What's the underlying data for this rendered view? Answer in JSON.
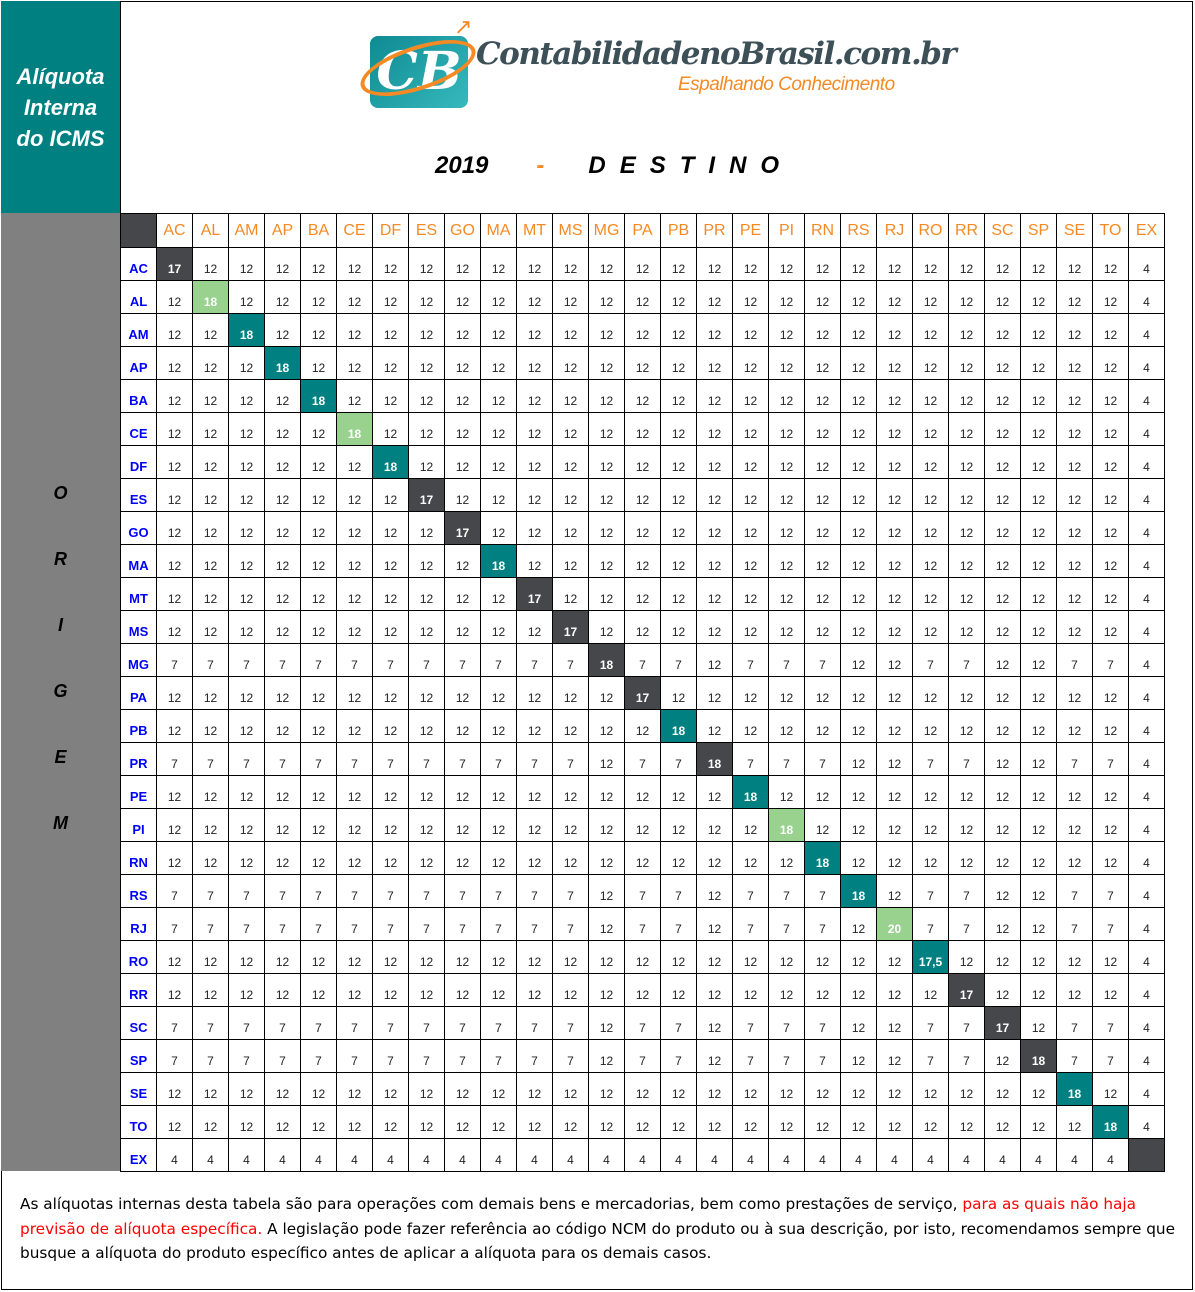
{
  "title": {
    "line1": "Alíquota",
    "line2": "Interna",
    "line3": "do ICMS"
  },
  "logo": {
    "mark": "CB",
    "name": "ContabilidadenoBrasil.com.br",
    "tagline": "Espalhando Conhecimento"
  },
  "heading": {
    "year": "2019",
    "dash": "-",
    "label": "DESTINO"
  },
  "origin_label": [
    "O",
    "R",
    "I",
    "G",
    "E",
    "M"
  ],
  "colors": {
    "teal": "#008080",
    "dark": "#46474b",
    "green": "#99d18f",
    "header_text": "#f58a25",
    "row_label": "#0000ff",
    "highlight": "#ff0000"
  },
  "table": {
    "columns": [
      "AC",
      "AL",
      "AM",
      "AP",
      "BA",
      "CE",
      "DF",
      "ES",
      "GO",
      "MA",
      "MT",
      "MS",
      "MG",
      "PA",
      "PB",
      "PR",
      "PE",
      "PI",
      "RN",
      "RS",
      "RJ",
      "RO",
      "RR",
      "SC",
      "SP",
      "SE",
      "TO",
      "EX"
    ],
    "rows": [
      {
        "origin": "AC",
        "diag": "dark",
        "values": [
          "17",
          "12",
          "12",
          "12",
          "12",
          "12",
          "12",
          "12",
          "12",
          "12",
          "12",
          "12",
          "12",
          "12",
          "12",
          "12",
          "12",
          "12",
          "12",
          "12",
          "12",
          "12",
          "12",
          "12",
          "12",
          "12",
          "12",
          "4"
        ]
      },
      {
        "origin": "AL",
        "diag": "green",
        "values": [
          "12",
          "18",
          "12",
          "12",
          "12",
          "12",
          "12",
          "12",
          "12",
          "12",
          "12",
          "12",
          "12",
          "12",
          "12",
          "12",
          "12",
          "12",
          "12",
          "12",
          "12",
          "12",
          "12",
          "12",
          "12",
          "12",
          "12",
          "4"
        ]
      },
      {
        "origin": "AM",
        "diag": "teal",
        "values": [
          "12",
          "12",
          "18",
          "12",
          "12",
          "12",
          "12",
          "12",
          "12",
          "12",
          "12",
          "12",
          "12",
          "12",
          "12",
          "12",
          "12",
          "12",
          "12",
          "12",
          "12",
          "12",
          "12",
          "12",
          "12",
          "12",
          "12",
          "4"
        ]
      },
      {
        "origin": "AP",
        "diag": "teal",
        "values": [
          "12",
          "12",
          "12",
          "18",
          "12",
          "12",
          "12",
          "12",
          "12",
          "12",
          "12",
          "12",
          "12",
          "12",
          "12",
          "12",
          "12",
          "12",
          "12",
          "12",
          "12",
          "12",
          "12",
          "12",
          "12",
          "12",
          "12",
          "4"
        ]
      },
      {
        "origin": "BA",
        "diag": "teal",
        "values": [
          "12",
          "12",
          "12",
          "12",
          "18",
          "12",
          "12",
          "12",
          "12",
          "12",
          "12",
          "12",
          "12",
          "12",
          "12",
          "12",
          "12",
          "12",
          "12",
          "12",
          "12",
          "12",
          "12",
          "12",
          "12",
          "12",
          "12",
          "4"
        ]
      },
      {
        "origin": "CE",
        "diag": "green",
        "values": [
          "12",
          "12",
          "12",
          "12",
          "12",
          "18",
          "12",
          "12",
          "12",
          "12",
          "12",
          "12",
          "12",
          "12",
          "12",
          "12",
          "12",
          "12",
          "12",
          "12",
          "12",
          "12",
          "12",
          "12",
          "12",
          "12",
          "12",
          "4"
        ]
      },
      {
        "origin": "DF",
        "diag": "teal",
        "values": [
          "12",
          "12",
          "12",
          "12",
          "12",
          "12",
          "18",
          "12",
          "12",
          "12",
          "12",
          "12",
          "12",
          "12",
          "12",
          "12",
          "12",
          "12",
          "12",
          "12",
          "12",
          "12",
          "12",
          "12",
          "12",
          "12",
          "12",
          "4"
        ]
      },
      {
        "origin": "ES",
        "diag": "dark",
        "values": [
          "12",
          "12",
          "12",
          "12",
          "12",
          "12",
          "12",
          "17",
          "12",
          "12",
          "12",
          "12",
          "12",
          "12",
          "12",
          "12",
          "12",
          "12",
          "12",
          "12",
          "12",
          "12",
          "12",
          "12",
          "12",
          "12",
          "12",
          "4"
        ]
      },
      {
        "origin": "GO",
        "diag": "dark",
        "values": [
          "12",
          "12",
          "12",
          "12",
          "12",
          "12",
          "12",
          "12",
          "17",
          "12",
          "12",
          "12",
          "12",
          "12",
          "12",
          "12",
          "12",
          "12",
          "12",
          "12",
          "12",
          "12",
          "12",
          "12",
          "12",
          "12",
          "12",
          "4"
        ]
      },
      {
        "origin": "MA",
        "diag": "teal",
        "values": [
          "12",
          "12",
          "12",
          "12",
          "12",
          "12",
          "12",
          "12",
          "12",
          "18",
          "12",
          "12",
          "12",
          "12",
          "12",
          "12",
          "12",
          "12",
          "12",
          "12",
          "12",
          "12",
          "12",
          "12",
          "12",
          "12",
          "12",
          "4"
        ]
      },
      {
        "origin": "MT",
        "diag": "dark",
        "values": [
          "12",
          "12",
          "12",
          "12",
          "12",
          "12",
          "12",
          "12",
          "12",
          "12",
          "17",
          "12",
          "12",
          "12",
          "12",
          "12",
          "12",
          "12",
          "12",
          "12",
          "12",
          "12",
          "12",
          "12",
          "12",
          "12",
          "12",
          "4"
        ]
      },
      {
        "origin": "MS",
        "diag": "dark",
        "values": [
          "12",
          "12",
          "12",
          "12",
          "12",
          "12",
          "12",
          "12",
          "12",
          "12",
          "12",
          "17",
          "12",
          "12",
          "12",
          "12",
          "12",
          "12",
          "12",
          "12",
          "12",
          "12",
          "12",
          "12",
          "12",
          "12",
          "12",
          "4"
        ]
      },
      {
        "origin": "MG",
        "diag": "dark",
        "values": [
          "7",
          "7",
          "7",
          "7",
          "7",
          "7",
          "7",
          "7",
          "7",
          "7",
          "7",
          "7",
          "18",
          "7",
          "7",
          "12",
          "7",
          "7",
          "7",
          "12",
          "12",
          "7",
          "7",
          "12",
          "12",
          "7",
          "7",
          "4"
        ]
      },
      {
        "origin": "PA",
        "diag": "dark",
        "values": [
          "12",
          "12",
          "12",
          "12",
          "12",
          "12",
          "12",
          "12",
          "12",
          "12",
          "12",
          "12",
          "12",
          "17",
          "12",
          "12",
          "12",
          "12",
          "12",
          "12",
          "12",
          "12",
          "12",
          "12",
          "12",
          "12",
          "12",
          "4"
        ]
      },
      {
        "origin": "PB",
        "diag": "teal",
        "values": [
          "12",
          "12",
          "12",
          "12",
          "12",
          "12",
          "12",
          "12",
          "12",
          "12",
          "12",
          "12",
          "12",
          "12",
          "18",
          "12",
          "12",
          "12",
          "12",
          "12",
          "12",
          "12",
          "12",
          "12",
          "12",
          "12",
          "12",
          "4"
        ]
      },
      {
        "origin": "PR",
        "diag": "dark",
        "values": [
          "7",
          "7",
          "7",
          "7",
          "7",
          "7",
          "7",
          "7",
          "7",
          "7",
          "7",
          "7",
          "12",
          "7",
          "7",
          "18",
          "7",
          "7",
          "7",
          "12",
          "12",
          "7",
          "7",
          "12",
          "12",
          "7",
          "7",
          "4"
        ]
      },
      {
        "origin": "PE",
        "diag": "teal",
        "values": [
          "12",
          "12",
          "12",
          "12",
          "12",
          "12",
          "12",
          "12",
          "12",
          "12",
          "12",
          "12",
          "12",
          "12",
          "12",
          "12",
          "18",
          "12",
          "12",
          "12",
          "12",
          "12",
          "12",
          "12",
          "12",
          "12",
          "12",
          "4"
        ]
      },
      {
        "origin": "PI",
        "diag": "green",
        "values": [
          "12",
          "12",
          "12",
          "12",
          "12",
          "12",
          "12",
          "12",
          "12",
          "12",
          "12",
          "12",
          "12",
          "12",
          "12",
          "12",
          "12",
          "18",
          "12",
          "12",
          "12",
          "12",
          "12",
          "12",
          "12",
          "12",
          "12",
          "4"
        ]
      },
      {
        "origin": "RN",
        "diag": "teal",
        "values": [
          "12",
          "12",
          "12",
          "12",
          "12",
          "12",
          "12",
          "12",
          "12",
          "12",
          "12",
          "12",
          "12",
          "12",
          "12",
          "12",
          "12",
          "12",
          "18",
          "12",
          "12",
          "12",
          "12",
          "12",
          "12",
          "12",
          "12",
          "4"
        ]
      },
      {
        "origin": "RS",
        "diag": "teal",
        "values": [
          "7",
          "7",
          "7",
          "7",
          "7",
          "7",
          "7",
          "7",
          "7",
          "7",
          "7",
          "7",
          "12",
          "7",
          "7",
          "12",
          "7",
          "7",
          "7",
          "18",
          "12",
          "7",
          "7",
          "12",
          "12",
          "7",
          "7",
          "4"
        ]
      },
      {
        "origin": "RJ",
        "diag": "green",
        "values": [
          "7",
          "7",
          "7",
          "7",
          "7",
          "7",
          "7",
          "7",
          "7",
          "7",
          "7",
          "7",
          "12",
          "7",
          "7",
          "12",
          "7",
          "7",
          "7",
          "12",
          "20",
          "7",
          "7",
          "12",
          "12",
          "7",
          "7",
          "4"
        ]
      },
      {
        "origin": "RO",
        "diag": "teal",
        "values": [
          "12",
          "12",
          "12",
          "12",
          "12",
          "12",
          "12",
          "12",
          "12",
          "12",
          "12",
          "12",
          "12",
          "12",
          "12",
          "12",
          "12",
          "12",
          "12",
          "12",
          "12",
          "17,5",
          "12",
          "12",
          "12",
          "12",
          "12",
          "4"
        ]
      },
      {
        "origin": "RR",
        "diag": "dark",
        "values": [
          "12",
          "12",
          "12",
          "12",
          "12",
          "12",
          "12",
          "12",
          "12",
          "12",
          "12",
          "12",
          "12",
          "12",
          "12",
          "12",
          "12",
          "12",
          "12",
          "12",
          "12",
          "12",
          "17",
          "12",
          "12",
          "12",
          "12",
          "4"
        ]
      },
      {
        "origin": "SC",
        "diag": "dark",
        "values": [
          "7",
          "7",
          "7",
          "7",
          "7",
          "7",
          "7",
          "7",
          "7",
          "7",
          "7",
          "7",
          "12",
          "7",
          "7",
          "12",
          "7",
          "7",
          "7",
          "12",
          "12",
          "7",
          "7",
          "17",
          "12",
          "7",
          "7",
          "4"
        ]
      },
      {
        "origin": "SP",
        "diag": "dark",
        "values": [
          "7",
          "7",
          "7",
          "7",
          "7",
          "7",
          "7",
          "7",
          "7",
          "7",
          "7",
          "7",
          "12",
          "7",
          "7",
          "12",
          "7",
          "7",
          "7",
          "12",
          "12",
          "7",
          "7",
          "12",
          "18",
          "7",
          "7",
          "4"
        ]
      },
      {
        "origin": "SE",
        "diag": "teal",
        "values": [
          "12",
          "12",
          "12",
          "12",
          "12",
          "12",
          "12",
          "12",
          "12",
          "12",
          "12",
          "12",
          "12",
          "12",
          "12",
          "12",
          "12",
          "12",
          "12",
          "12",
          "12",
          "12",
          "12",
          "12",
          "12",
          "18",
          "12",
          "4"
        ]
      },
      {
        "origin": "TO",
        "diag": "teal",
        "values": [
          "12",
          "12",
          "12",
          "12",
          "12",
          "12",
          "12",
          "12",
          "12",
          "12",
          "12",
          "12",
          "12",
          "12",
          "12",
          "12",
          "12",
          "12",
          "12",
          "12",
          "12",
          "12",
          "12",
          "12",
          "12",
          "12",
          "18",
          "4"
        ]
      },
      {
        "origin": "EX",
        "diag": "blank",
        "values": [
          "4",
          "4",
          "4",
          "4",
          "4",
          "4",
          "4",
          "4",
          "4",
          "4",
          "4",
          "4",
          "4",
          "4",
          "4",
          "4",
          "4",
          "4",
          "4",
          "4",
          "4",
          "4",
          "4",
          "4",
          "4",
          "4",
          "4",
          ""
        ]
      }
    ]
  },
  "footer": {
    "part1": "As alíquotas internas desta tabela são para operações com demais bens e mercadorias, bem como prestações de serviço, ",
    "highlight": "para as quais não haja previsão de alíquota específica.",
    "part2": "  A legislação pode fazer referência ao código NCM do produto ou à sua descrição, por isto, recomendamos sempre que busque a alíquota do produto específico antes de aplicar  a alíquota para os demais casos."
  }
}
